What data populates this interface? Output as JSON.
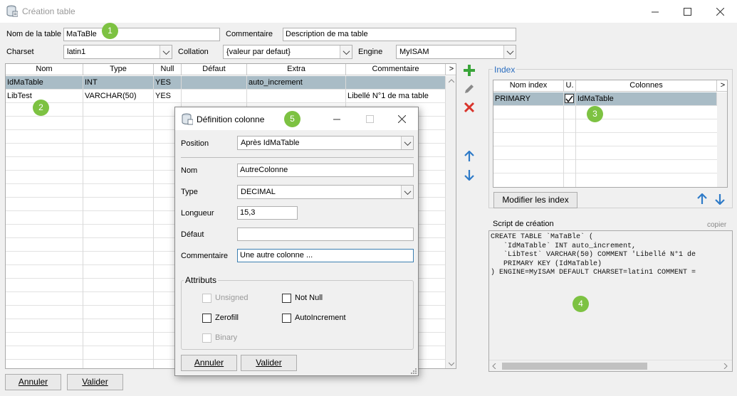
{
  "window": {
    "title": "Création table"
  },
  "form": {
    "table_name_label": "Nom de la table",
    "table_name_value": "MaTaBle",
    "comment_label": "Commentaire",
    "comment_value": "Description de ma table",
    "charset_label": "Charset",
    "charset_value": "latin1",
    "collation_label": "Collation",
    "collation_value": "{valeur par defaut}",
    "engine_label": "Engine",
    "engine_value": "MyISAM"
  },
  "badges": {
    "b1": "1",
    "b2": "2",
    "b3": "3",
    "b4": "4",
    "b5": "5"
  },
  "grid": {
    "headers": [
      "Nom",
      "Type",
      "Null",
      "Défaut",
      "Extra",
      "Commentaire",
      ">"
    ],
    "rows": [
      [
        "IdMaTable",
        "INT",
        "YES",
        "",
        "auto_increment",
        ""
      ],
      [
        "LibTest",
        "VARCHAR(50)",
        "YES",
        "",
        "",
        "Libellé N°1 de ma table"
      ]
    ]
  },
  "toolbar": {
    "add": "add-icon",
    "edit": "edit-icon",
    "delete": "delete-icon",
    "up": "arrow-up-icon",
    "down": "arrow-down-icon"
  },
  "index": {
    "title": "Index",
    "headers": [
      "Nom index",
      "U.",
      "Colonnes",
      ">"
    ],
    "rows": [
      {
        "name": "PRIMARY",
        "unique": true,
        "columns": "IdMaTable"
      }
    ],
    "modify_button": "Modifier les index"
  },
  "script": {
    "label": "Script de création",
    "copy_link": "copier",
    "lines": [
      "CREATE TABLE `MaTaBle` (",
      "   `IdMaTable` INT auto_increment,",
      "   `LibTest` VARCHAR(50) COMMENT 'Libellé N°1 de",
      "   PRIMARY KEY (IdMaTable)",
      ") ENGINE=MyISAM DEFAULT CHARSET=latin1 COMMENT ="
    ]
  },
  "buttons": {
    "cancel": "Annuler",
    "validate": "Valider"
  },
  "dialog": {
    "title": "Définition colonne",
    "position_label": "Position",
    "position_value": "Après IdMaTable",
    "name_label": "Nom",
    "name_value": "AutreColonne",
    "type_label": "Type",
    "type_value": "DECIMAL",
    "length_label": "Longueur",
    "length_value": "15,3",
    "default_label": "Défaut",
    "default_value": "",
    "comment_label": "Commentaire",
    "comment_value": "Une autre colonne ...",
    "attributes_title": "Attributs",
    "unsigned": "Unsigned",
    "not_null": "Not Null",
    "zerofill": "Zerofill",
    "autoincrement": "AutoIncrement",
    "binary": "Binary",
    "cancel": "Annuler",
    "validate": "Valider"
  }
}
